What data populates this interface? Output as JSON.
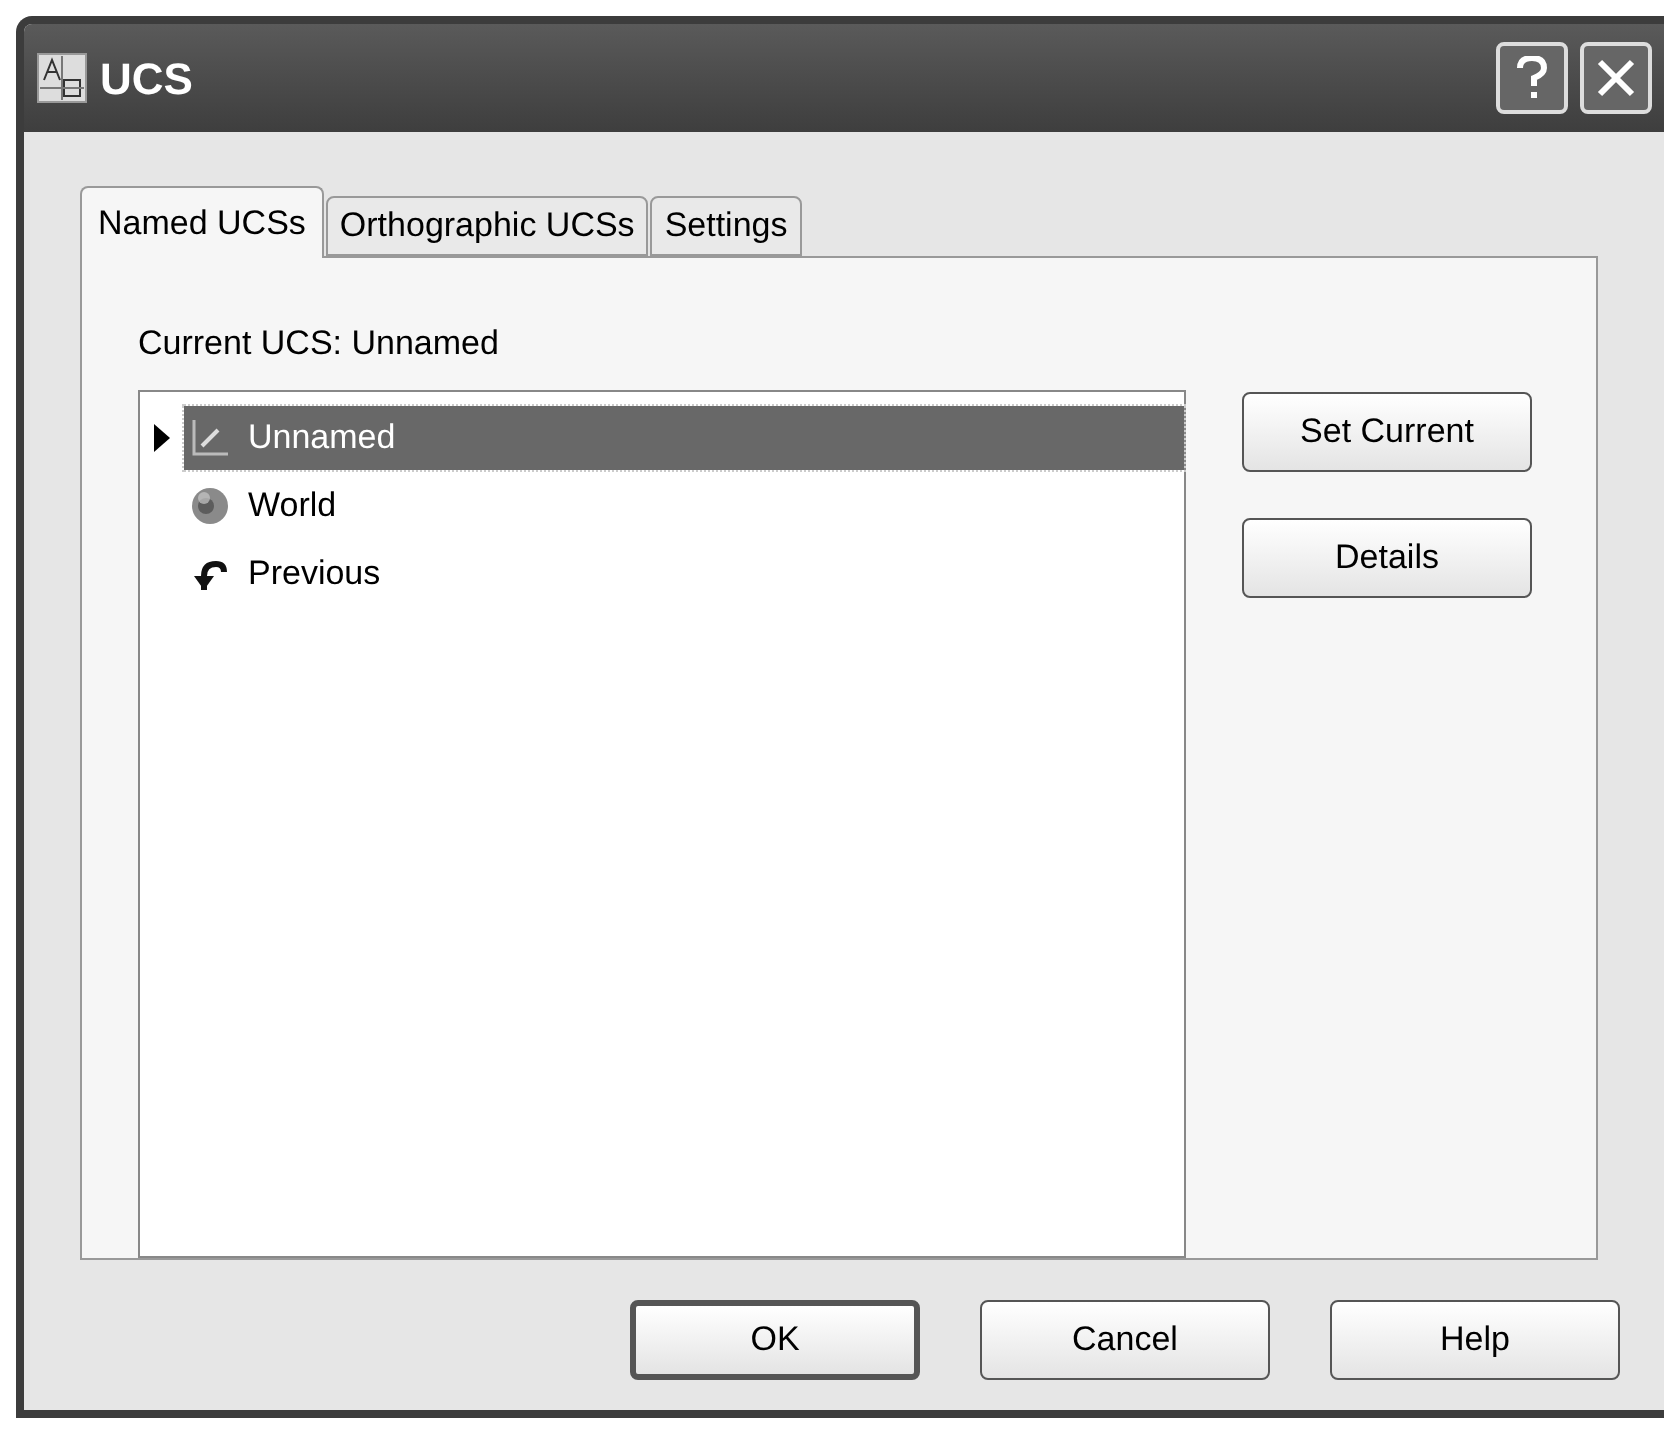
{
  "window": {
    "title": "UCS"
  },
  "tabs": [
    {
      "label": "Named UCSs",
      "selected": true
    },
    {
      "label": "Orthographic UCSs",
      "selected": false
    },
    {
      "label": "Settings",
      "selected": false
    }
  ],
  "current_label": "Current UCS:  Unnamed",
  "ucs_list": [
    {
      "kind": "named",
      "label": "Unnamed",
      "selected": true,
      "current": true
    },
    {
      "kind": "world",
      "label": "World",
      "selected": false,
      "current": false
    },
    {
      "kind": "previous",
      "label": "Previous",
      "selected": false,
      "current": false
    }
  ],
  "side_buttons": [
    "Set Current",
    "Details"
  ],
  "buttons": [
    {
      "label": "OK",
      "default": true
    },
    {
      "label": "Cancel",
      "default": false
    },
    {
      "label": "Help",
      "default": false
    }
  ]
}
